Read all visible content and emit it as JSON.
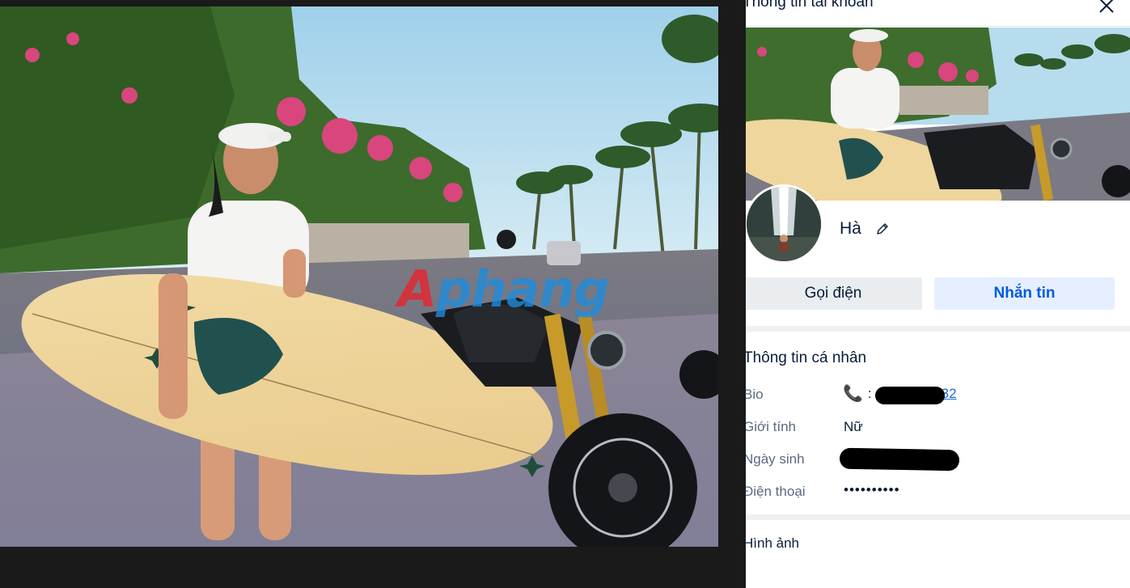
{
  "panel": {
    "title": "Thông tin tài khoản",
    "name": "Hà",
    "buttons": {
      "call": "Gọi điện",
      "message": "Nhắn tin"
    },
    "personal": {
      "title": "Thông tin cá nhân",
      "rows": [
        {
          "label": "Bio",
          "value": "32",
          "icon": "phone-icon"
        },
        {
          "label": "Giới tính",
          "value": "Nữ"
        },
        {
          "label": "Ngày sinh",
          "value": ""
        },
        {
          "label": "Điện thoại",
          "value": "••••••••••"
        }
      ]
    },
    "photos_title": "Hình ảnh"
  },
  "viewer": {
    "watermark_part1": "A",
    "watermark_part2": "phang"
  },
  "colors": {
    "accent": "#005ae0",
    "primary_button_bg": "#e5efff",
    "secondary_button_bg": "#eaedf0",
    "link": "#1e6cd8",
    "viewer_bg": "#1a1a1a"
  }
}
